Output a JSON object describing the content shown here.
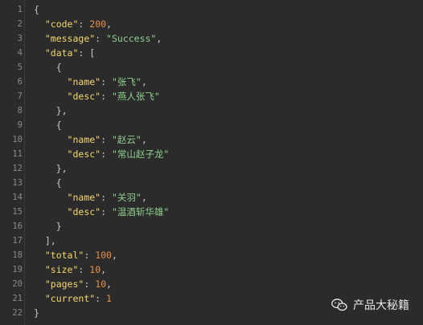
{
  "gutter": [
    "1",
    "2",
    "3",
    "4",
    "5",
    "6",
    "7",
    "8",
    "9",
    "10",
    "11",
    "12",
    "13",
    "14",
    "15",
    "16",
    "17",
    "18",
    "19",
    "20",
    "21",
    "22"
  ],
  "code": {
    "l1": {
      "p1": "{"
    },
    "l2": {
      "k": "\"code\"",
      "p1": ": ",
      "v": "200",
      "p2": ","
    },
    "l3": {
      "k": "\"message\"",
      "p1": ": ",
      "v": "\"Success\"",
      "p2": ","
    },
    "l4": {
      "k": "\"data\"",
      "p1": ": ["
    },
    "l5": {
      "p1": "{"
    },
    "l6": {
      "k": "\"name\"",
      "p1": ": ",
      "v": "\"张飞\"",
      "p2": ","
    },
    "l7": {
      "k": "\"desc\"",
      "p1": ": ",
      "v": "\"燕人张飞\""
    },
    "l8": {
      "p1": "},"
    },
    "l9": {
      "p1": "{"
    },
    "l10": {
      "k": "\"name\"",
      "p1": ": ",
      "v": "\"赵云\"",
      "p2": ","
    },
    "l11": {
      "k": "\"desc\"",
      "p1": ": ",
      "v": "\"常山赵子龙\""
    },
    "l12": {
      "p1": "},"
    },
    "l13": {
      "p1": "{"
    },
    "l14": {
      "k": "\"name\"",
      "p1": ": ",
      "v": "\"关羽\"",
      "p2": ","
    },
    "l15": {
      "k": "\"desc\"",
      "p1": ": ",
      "v": "\"温酒斩华雄\""
    },
    "l16": {
      "p1": "}"
    },
    "l17": {
      "p1": "],"
    },
    "l18": {
      "k": "\"total\"",
      "p1": ": ",
      "v": "100",
      "p2": ","
    },
    "l19": {
      "k": "\"size\"",
      "p1": ": ",
      "v": "10",
      "p2": ","
    },
    "l20": {
      "k": "\"pages\"",
      "p1": ": ",
      "v": "10",
      "p2": ","
    },
    "l21": {
      "k": "\"current\"",
      "p1": ": ",
      "v": "1"
    },
    "l22": {
      "p1": "}"
    }
  },
  "watermark": {
    "icon": "wechat-icon",
    "text": "产品大秘籍"
  },
  "colors": {
    "background": "#2b2b2b",
    "key": "#f5d76e",
    "string": "#8fd18f",
    "number": "#e8914a",
    "punctuation": "#c8c8c8",
    "line_number": "#8a8a8a"
  }
}
